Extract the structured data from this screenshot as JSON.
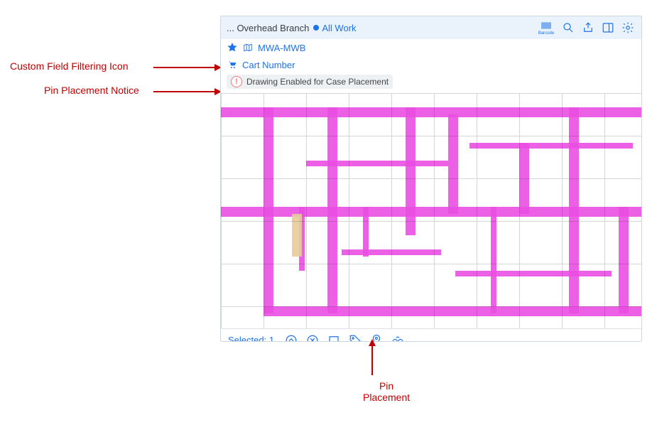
{
  "annotations": {
    "custom_filter": "Custom Field Filtering Icon",
    "pin_notice": "Pin Placement Notice",
    "pin_placement_l1": "Pin",
    "pin_placement_l2": "Placement"
  },
  "topbar": {
    "breadcrumb": "... Overhead Branch",
    "filter_label": "All Work",
    "barcode_label": "Barcode"
  },
  "meta": {
    "drawing_name": "MWA-MWB",
    "cart_label": "Cart Number"
  },
  "notice": {
    "text": "Drawing Enabled for Case Placement"
  },
  "bottombar": {
    "selected_label": "Selected: 1"
  }
}
